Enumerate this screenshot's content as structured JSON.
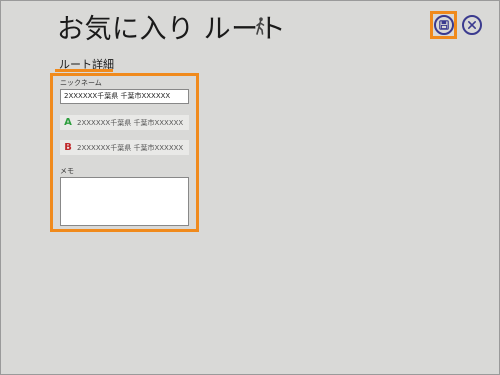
{
  "header": {
    "title": "お気に入り ルート"
  },
  "icons": {
    "walk": "walk-icon",
    "save": "save-icon",
    "close": "close-icon"
  },
  "section": {
    "title": "ルート詳細"
  },
  "form": {
    "nickname_label": "ニックネーム",
    "nickname_value": "2XXXXXX千葉県 千葉市XXXXXX",
    "route_a_letter": "A",
    "route_a_text": "2XXXXXX千葉県 千葉市XXXXXX",
    "route_b_letter": "B",
    "route_b_text": "2XXXXXX千葉県 千葉市XXXXXX",
    "memo_label": "メモ",
    "memo_value": ""
  },
  "colors": {
    "highlight": "#f08a1c",
    "button_accent": "#3b3b8f",
    "route_a": "#2e9e3e",
    "route_b": "#c0282a",
    "background": "#d9d9d7"
  }
}
